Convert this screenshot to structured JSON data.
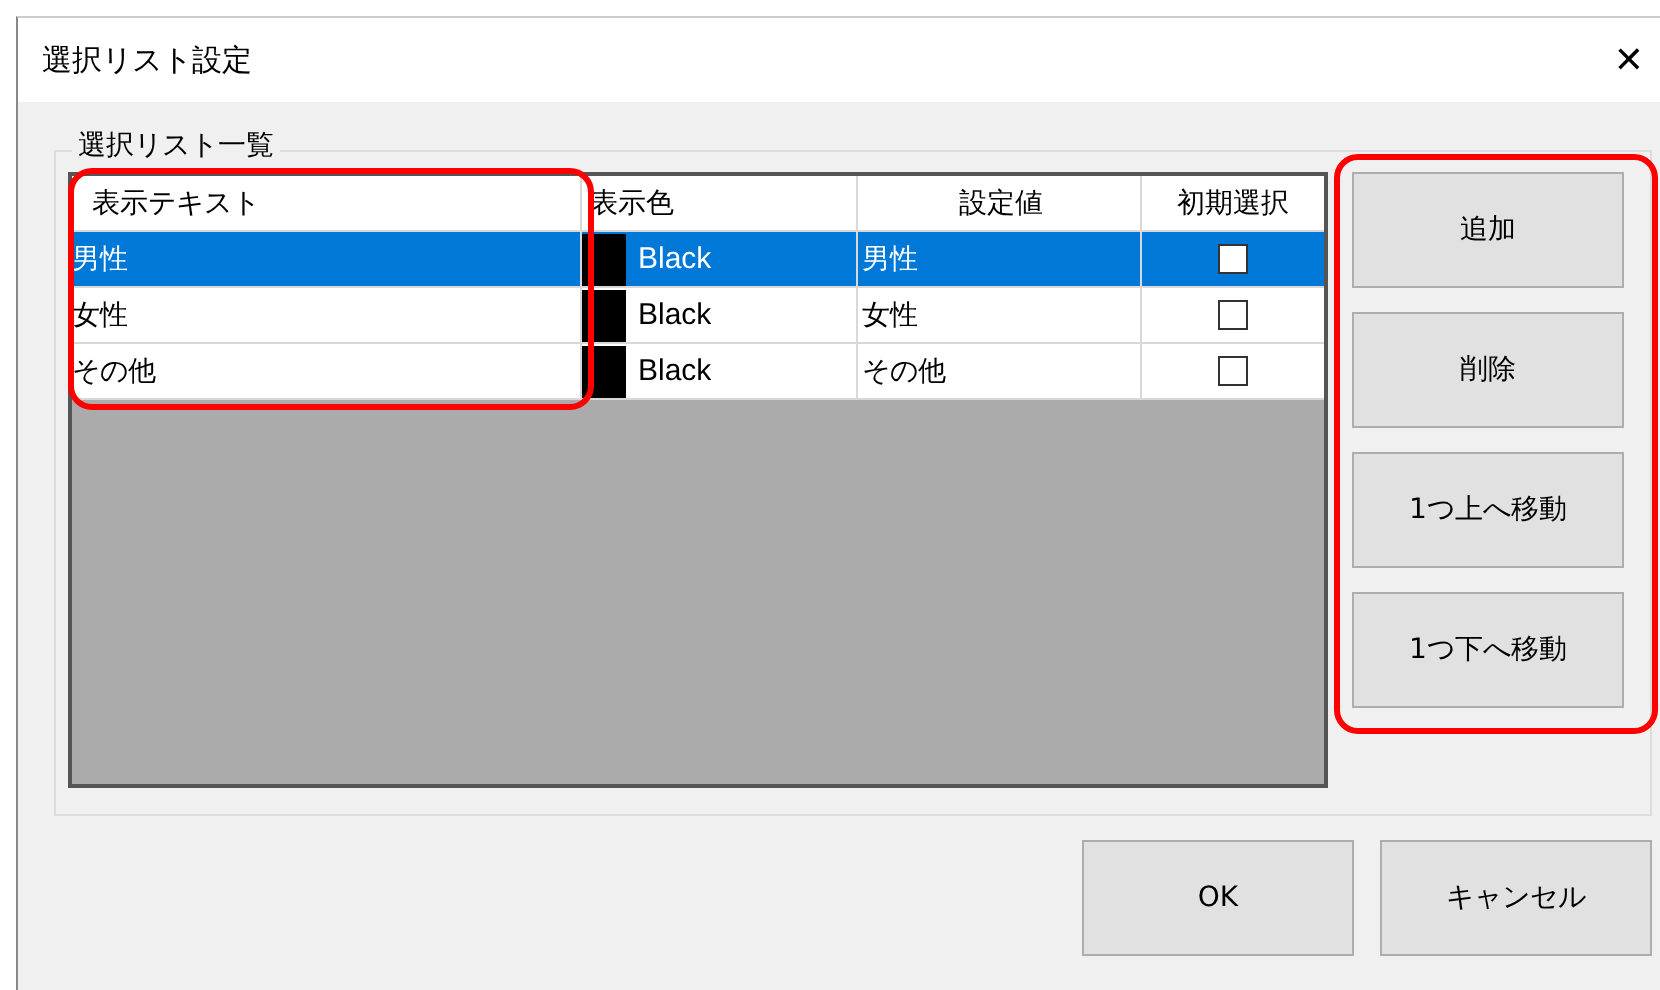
{
  "window": {
    "title": "選択リスト設定",
    "close": "✕"
  },
  "group": {
    "label": "選択リスト一覧"
  },
  "table": {
    "columns": [
      "表示テキスト",
      "表示色",
      "設定値",
      "初期選択"
    ],
    "rows": [
      {
        "text": "男性",
        "color_name": "Black",
        "color": "#000000",
        "value": "男性",
        "checked": false,
        "selected": true
      },
      {
        "text": "女性",
        "color_name": "Black",
        "color": "#000000",
        "value": "女性",
        "checked": false,
        "selected": false
      },
      {
        "text": "その他",
        "color_name": "Black",
        "color": "#000000",
        "value": "その他",
        "checked": false,
        "selected": false
      }
    ]
  },
  "side_buttons": [
    "追加",
    "削除",
    "1つ上へ移動",
    "1つ下へ移動"
  ],
  "footer_buttons": [
    "OK",
    "キャンセル"
  ]
}
